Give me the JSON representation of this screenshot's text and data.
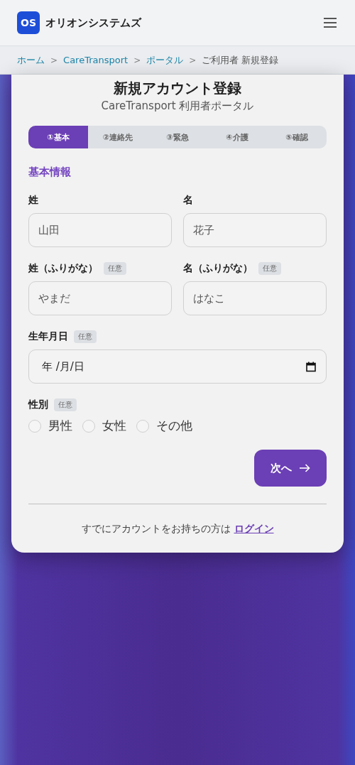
{
  "header": {
    "logo": "OS",
    "brand": "オリオンシステムズ"
  },
  "breadcrumb": [
    {
      "label": "ホーム",
      "link": true
    },
    {
      "label": "CareTransport",
      "link": true,
      "separator": ">"
    },
    {
      "label": "ポータル",
      "link": true,
      "separator": ">"
    },
    {
      "label": "ご利用者 新規登録",
      "link": false,
      "separator": ">"
    }
  ],
  "title": "新規アカウント登録",
  "subtitle": "CareTransport 利用者ポータル",
  "steps": [
    {
      "label": "①基本",
      "selected": true
    },
    {
      "label": "②連絡先",
      "selected": false
    },
    {
      "label": "③緊急",
      "selected": false
    },
    {
      "label": "④介護",
      "selected": false
    },
    {
      "label": "⑤確認",
      "selected": false
    }
  ],
  "section_title": "基本情報",
  "fields": [
    {
      "kind": "text",
      "label": "姓",
      "placeholder": "山田"
    },
    {
      "kind": "text",
      "label": "名",
      "placeholder": "花子"
    },
    {
      "kind": "text",
      "label": "姓（ふりがな）",
      "badge": "任意",
      "placeholder": "やまだ"
    },
    {
      "kind": "text",
      "label": "名（ふりがな）",
      "badge": "任意",
      "placeholder": "はなこ"
    },
    {
      "kind": "date",
      "label": "生年月日",
      "badge": "任意",
      "placeholder": "年 /月/日"
    },
    {
      "kind": "radio",
      "label": "性別",
      "badge": "任意",
      "options": [
        {
          "label": "男性",
          "selected": false
        },
        {
          "label": "女性",
          "selected": false
        },
        {
          "label": "その他",
          "selected": false
        }
      ]
    }
  ],
  "next_button": "次へ",
  "footer": {
    "text": "すでにアカウントをお持ちの方は",
    "link": "ログイン"
  }
}
